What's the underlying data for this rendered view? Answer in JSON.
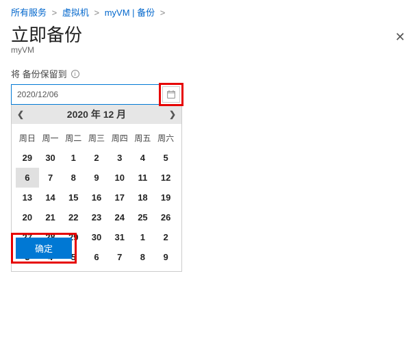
{
  "breadcrumb": {
    "items": [
      {
        "label": "所有服务"
      },
      {
        "label": "虚拟机"
      },
      {
        "label": "myVM | 备份"
      }
    ]
  },
  "page": {
    "title": "立即备份",
    "subtitle": "myVM"
  },
  "field": {
    "label": "将 备份保留到",
    "value": "2020/12/06"
  },
  "calendar": {
    "month_label": "2020 年 12 月",
    "dow": [
      "周日",
      "周一",
      "周二",
      "周三",
      "周四",
      "周五",
      "周六"
    ],
    "weeks": [
      [
        "29",
        "30",
        "1",
        "2",
        "3",
        "4",
        "5"
      ],
      [
        "6",
        "7",
        "8",
        "9",
        "10",
        "11",
        "12"
      ],
      [
        "13",
        "14",
        "15",
        "16",
        "17",
        "18",
        "19"
      ],
      [
        "20",
        "21",
        "22",
        "23",
        "24",
        "25",
        "26"
      ],
      [
        "27",
        "28",
        "29",
        "30",
        "31",
        "1",
        "2"
      ],
      [
        "3",
        "4",
        "5",
        "6",
        "7",
        "8",
        "9"
      ]
    ],
    "selected": "6"
  },
  "actions": {
    "ok_label": "确定"
  }
}
